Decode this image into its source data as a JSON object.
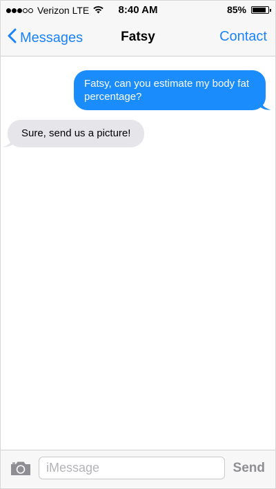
{
  "status_bar": {
    "carrier": "Verizon LTE",
    "signal_bars_filled": 3,
    "signal_bars_total": 5,
    "time": "8:40 AM",
    "battery_text": "85%",
    "battery_level": 0.85,
    "wifi_icon": "wifi-icon"
  },
  "nav": {
    "back_label": "Messages",
    "back_icon": "chevron-left-icon",
    "title": "Fatsy",
    "contact_label": "Contact"
  },
  "messages": [
    {
      "direction": "sent",
      "text": "Fatsy, can you estimate my body fat percentage?"
    },
    {
      "direction": "received",
      "text": "Sure, send us a picture!"
    }
  ],
  "input_bar": {
    "camera_icon": "camera-icon",
    "placeholder": "iMessage",
    "value": "",
    "send_label": "Send"
  },
  "colors": {
    "accent": "#1a82fb",
    "sent_bubble": "#1a8cfb",
    "received_bubble": "#e5e5ea",
    "send_disabled": "#8e8e93"
  }
}
